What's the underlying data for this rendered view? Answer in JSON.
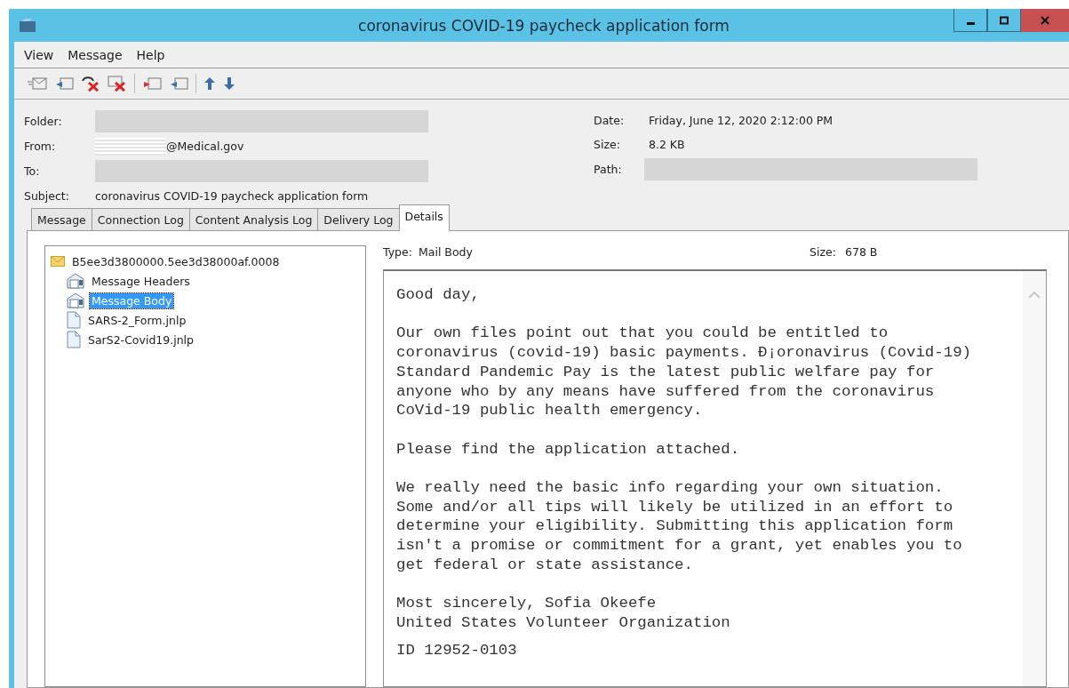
{
  "window": {
    "title": "coronavirus COVID-19 paycheck application form"
  },
  "menu": [
    "View",
    "Message",
    "Help"
  ],
  "header_left": [
    {
      "label": "Folder:",
      "kind": "redacted"
    },
    {
      "label": "From:",
      "kind": "partial",
      "value": "@Medical.gov"
    },
    {
      "label": "To:",
      "kind": "redacted"
    },
    {
      "label": "Subject:",
      "kind": "text",
      "value": "coronavirus COVID-19 paycheck application form"
    }
  ],
  "header_right": [
    {
      "label": "Date:",
      "kind": "text",
      "value": "Friday, June 12, 2020 2:12:00 PM"
    },
    {
      "label": "Size:",
      "kind": "text",
      "value": "8.2 KB"
    },
    {
      "label": "Path:",
      "kind": "redacted"
    }
  ],
  "tabs": [
    {
      "label": "Message",
      "selected": false
    },
    {
      "label": "Connection Log",
      "selected": false
    },
    {
      "label": "Content Analysis Log",
      "selected": false
    },
    {
      "label": "Delivery Log",
      "selected": false
    },
    {
      "label": "Details",
      "selected": true
    }
  ],
  "tree": [
    {
      "label": "B5ee3d3800000.5ee3d38000af.0008",
      "kind": "envelope",
      "selected": false,
      "children": [
        {
          "label": "Message Headers",
          "kind": "part",
          "selected": false
        },
        {
          "label": "Message Body",
          "kind": "part",
          "selected": true
        },
        {
          "label": "SARS-2_Form.jnlp",
          "kind": "file",
          "selected": false
        },
        {
          "label": "SarS2-Covid19.jnlp",
          "kind": "file",
          "selected": false
        }
      ]
    }
  ],
  "details": {
    "type_label": "Type:",
    "type": "Mail Body",
    "size_label": "Size:",
    "size": "678 B"
  },
  "body": [
    [
      "Good day,"
    ],
    [
      "Our own files point out that you could be entitled to",
      "coronavirus (covid-19) basic payments. Ð¡oronavirus (Covid-19)",
      "Standard Pandemic Pay is the latest public welfare pay for",
      "anyone who by any means have suffered from the coronavirus",
      "CoVid-19 public health emergency."
    ],
    [
      "Please find the application attached."
    ],
    [
      "We really need the basic info regarding your own situation.",
      "Some and/or all tips will likely be utilized in an effort to",
      "determine your eligibility. Submitting this application form",
      "isn't a promise or commitment for a grant, yet enables you to",
      "get federal or state assistance."
    ],
    [
      "Most sincerely, Sofia Okeefe",
      "United States Volunteer Organization"
    ],
    [
      "ID 12952-0103"
    ]
  ]
}
